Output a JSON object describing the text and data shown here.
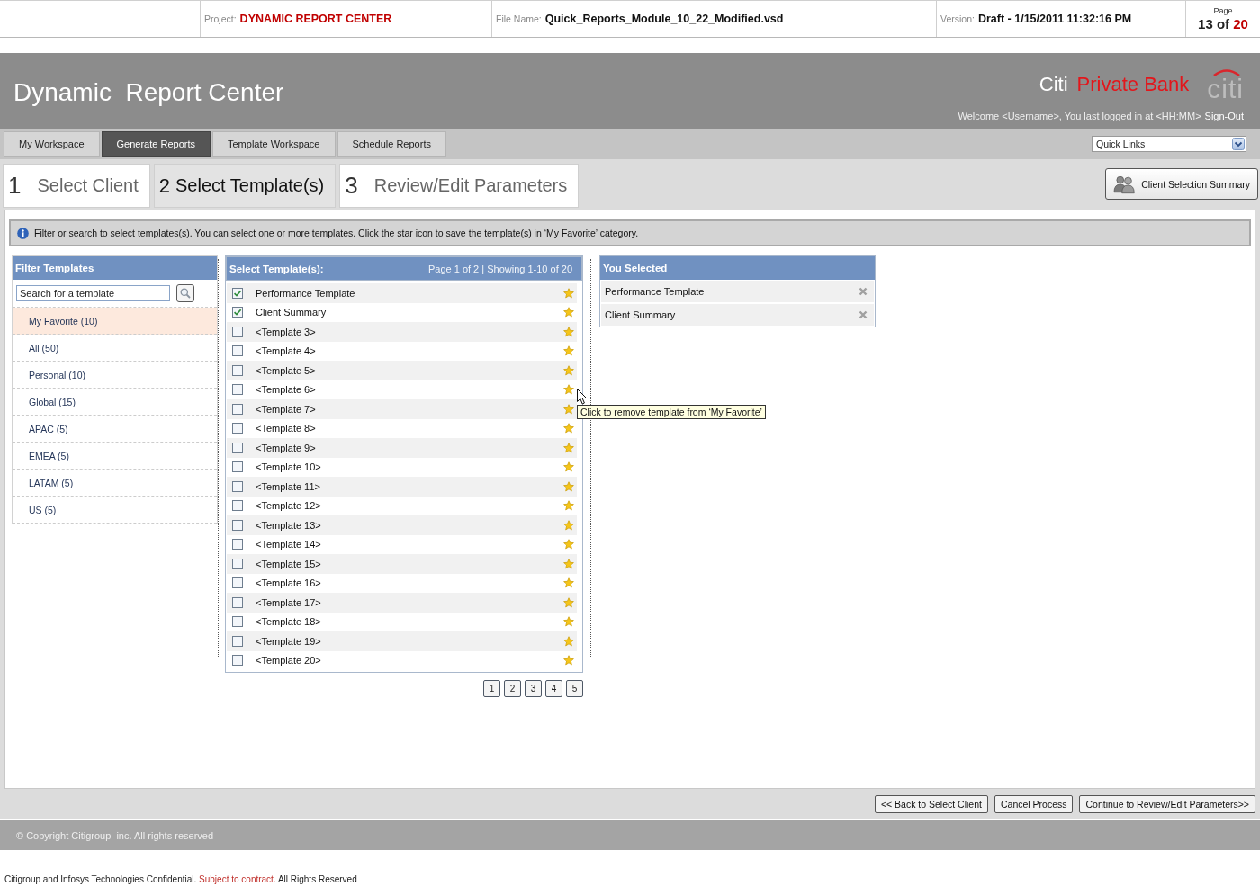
{
  "doc_header": {
    "project_label": "Project:",
    "project": "DYNAMIC REPORT CENTER",
    "file_label": "File Name:",
    "file": "Quick_Reports_Module_10_22_Modified.vsd",
    "version_label": "Version:",
    "version": "Draft - 1/15/2011 11:32:16 PM",
    "page_label": "Page",
    "page_current": "13 of",
    "page_total": "20"
  },
  "banner": {
    "title": "Dynamic  Report Center",
    "brand": "Citi",
    "brand_sub": "Private Bank",
    "logo": "citi",
    "welcome": "Welcome <Username>, You last logged in at <HH:MM>",
    "sign_out": "Sign-Out"
  },
  "nav_tabs": [
    {
      "label": "My Workspace",
      "selected": false
    },
    {
      "label": "Generate Reports",
      "selected": true
    },
    {
      "label": "Template Workspace",
      "selected": false
    },
    {
      "label": "Schedule Reports",
      "selected": false
    }
  ],
  "quick_links": {
    "value": "Quick Links"
  },
  "steps": [
    {
      "number": "1",
      "label": "Select Client",
      "selected": false
    },
    {
      "number": "2",
      "label": "Select Template(s)",
      "selected": true
    },
    {
      "number": "3",
      "label": "Review/Edit Parameters",
      "selected": false
    }
  ],
  "summary_button": "Client Selection Summary",
  "info": "Filter or search to select templates(s). You can select one or more templates. Click the star icon to save the template(s) in ‘My Favorite’ category.",
  "filter": {
    "title": "Filter Templates",
    "search": {
      "placeholder": "Search for a template"
    },
    "items": [
      {
        "label": "My Favorite (10)",
        "selected": true
      },
      {
        "label": "All (50)",
        "selected": false
      },
      {
        "label": "Personal (10)",
        "selected": false
      },
      {
        "label": "Global (15)",
        "selected": false
      },
      {
        "label": "APAC (5)",
        "selected": false
      },
      {
        "label": "EMEA (5)",
        "selected": false
      },
      {
        "label": "LATAM (5)",
        "selected": false
      },
      {
        "label": "US (5)",
        "selected": false
      }
    ]
  },
  "templates": {
    "title": "Select Template(s):",
    "paging": "Page 1 of 2 | Showing 1-10 of 20",
    "rows": [
      {
        "label": "Performance Template",
        "checked": true,
        "starred": true
      },
      {
        "label": "Client Summary",
        "checked": true,
        "starred": true
      },
      {
        "label": "<Template 3>",
        "checked": false,
        "starred": true
      },
      {
        "label": "<Template 4>",
        "checked": false,
        "starred": true
      },
      {
        "label": "<Template 5>",
        "checked": false,
        "starred": true
      },
      {
        "label": "<Template 6>",
        "checked": false,
        "starred": true
      },
      {
        "label": "<Template 7>",
        "checked": false,
        "starred": true
      },
      {
        "label": "<Template 8>",
        "checked": false,
        "starred": true
      },
      {
        "label": "<Template 9>",
        "checked": false,
        "starred": true
      },
      {
        "label": "<Template 10>",
        "checked": false,
        "starred": true
      },
      {
        "label": "<Template 11>",
        "checked": false,
        "starred": true
      },
      {
        "label": "<Template 12>",
        "checked": false,
        "starred": true
      },
      {
        "label": "<Template 13>",
        "checked": false,
        "starred": true
      },
      {
        "label": "<Template 14>",
        "checked": false,
        "starred": true
      },
      {
        "label": "<Template 15>",
        "checked": false,
        "starred": true
      },
      {
        "label": "<Template 16>",
        "checked": false,
        "starred": true
      },
      {
        "label": "<Template 17>",
        "checked": false,
        "starred": true
      },
      {
        "label": "<Template 18>",
        "checked": false,
        "starred": true
      },
      {
        "label": "<Template 19>",
        "checked": false,
        "starred": true
      },
      {
        "label": "<Template 20>",
        "checked": false,
        "starred": true
      }
    ],
    "pages": [
      "1",
      "2",
      "3",
      "4",
      "5"
    ],
    "tooltip": "Click to remove template from ‘My Favorite’"
  },
  "you_selected": {
    "title": "You Selected",
    "items": [
      "Performance Template",
      "Client Summary"
    ]
  },
  "actions": [
    "<< Back to Select Client",
    "Cancel Process",
    "Continue to Review/Edit Parameters>>"
  ],
  "footer": "© Copyright Citigroup  inc. All rights reserved",
  "confidential": [
    {
      "text": "Citigroup and Infosys Technologies Confidential.",
      "kind": "plain"
    },
    {
      "text": "Subject to contract.",
      "kind": "emphasis"
    },
    {
      "text": "All Rights Reserved",
      "kind": "plain"
    }
  ]
}
